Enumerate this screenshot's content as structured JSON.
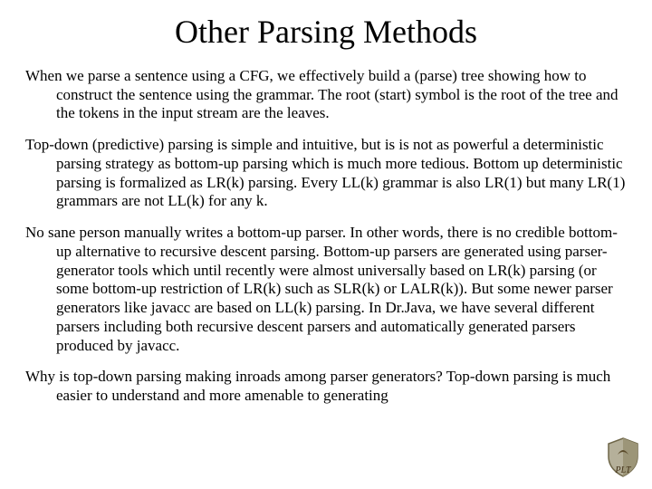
{
  "title": "Other Parsing Methods",
  "paragraphs": [
    "When we parse a sentence using a CFG, we effectively build a (parse) tree showing how to construct the sentence using the grammar.  The root (start) symbol is the root of the tree and the tokens in the input stream are the leaves.",
    "Top-down (predictive) parsing is simple and intuitive, but is is not as powerful a deterministic parsing strategy as bottom-up parsing which is much more tedious.  Bottom up deterministic parsing is formalized as LR(k) parsing.  Every LL(k) grammar is also LR(1) but many LR(1) grammars are not LL(k) for any k.",
    "No sane person manually writes a bottom-up parser.  In other words, there is no credible bottom-up alternative to recursive descent parsing.  Bottom-up parsers are generated using parser-generator tools which until recently were almost universally based on LR(k) parsing (or some bottom-up restriction of LR(k) such as SLR(k) or LALR(k)).   But some newer parser generators like javacc are based on LL(k) parsing.  In Dr.Java, we have several different parsers including both recursive descent parsers and automatically generated parsers produced by javacc.",
    "Why is top-down parsing making inroads among parser generators?  Top-down parsing is much easier to understand and more amenable to generating"
  ]
}
